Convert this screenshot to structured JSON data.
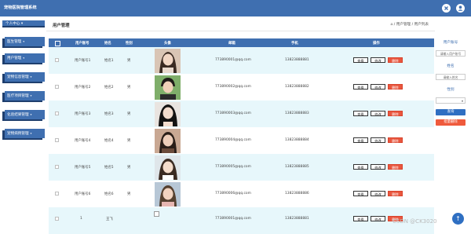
{
  "app": {
    "title": "宠物医院管理系统"
  },
  "top_icons": {
    "close": "close-icon",
    "user": "user-icon"
  },
  "sidebar": {
    "user_center": "个人中心",
    "items": [
      {
        "label": "医生管理"
      },
      {
        "label": "用户管理"
      },
      {
        "label": "宠物信息管理"
      },
      {
        "label": "医疗项目管理"
      },
      {
        "label": "化验结果管理"
      },
      {
        "label": "宠物病例管理"
      }
    ]
  },
  "header": {
    "page_title": "用户管理",
    "breadcrumb": {
      "home_icon": "home-icon",
      "section": "用户管理",
      "current": "用户列表"
    }
  },
  "table": {
    "columns": [
      "用户账号",
      "姓名",
      "性别",
      "头像",
      "邮箱",
      "手机",
      "操作"
    ],
    "actions": {
      "view": "查看",
      "edit": "修改",
      "delete": "删除"
    },
    "rows": [
      {
        "account": "用户账号1",
        "name": "姓名1",
        "gender": "男",
        "email": "773890001@qq.com",
        "phone": "13823888881",
        "avatar": "avatar-1"
      },
      {
        "account": "用户账号2",
        "name": "姓名2",
        "gender": "男",
        "email": "773890002@qq.com",
        "phone": "13823888882",
        "avatar": "avatar-2"
      },
      {
        "account": "用户账号3",
        "name": "姓名3",
        "gender": "男",
        "email": "773890003@qq.com",
        "phone": "13823888883",
        "avatar": "avatar-3"
      },
      {
        "account": "用户账号4",
        "name": "姓名4",
        "gender": "男",
        "email": "773890004@qq.com",
        "phone": "13823888884",
        "avatar": "avatar-4"
      },
      {
        "account": "用户账号5",
        "name": "姓名5",
        "gender": "男",
        "email": "773890005@qq.com",
        "phone": "13823888885",
        "avatar": "avatar-5"
      },
      {
        "account": "用户账号6",
        "name": "姓名6",
        "gender": "男",
        "email": "773890006@qq.com",
        "phone": "13823888886",
        "avatar": "avatar-6"
      },
      {
        "account": "1",
        "name": "王飞",
        "gender": "",
        "email": "773890001@qq.com",
        "phone": "13823888881",
        "avatar": "broken-image"
      }
    ]
  },
  "filter": {
    "account_label": "用户账号",
    "account_placeholder": "请输入用户账号",
    "name_label": "姓名",
    "name_placeholder": "请输入姓名",
    "gender_label": "性别",
    "gender_value": "",
    "search_button": "查询",
    "bulk_delete_button": "批量删除"
  },
  "watermark": "CSDN @CK3020",
  "colors": {
    "primary": "#3f6fb0",
    "row_alt": "#e7f7fb",
    "danger": "#e9573f",
    "search": "#2f6fc2"
  }
}
